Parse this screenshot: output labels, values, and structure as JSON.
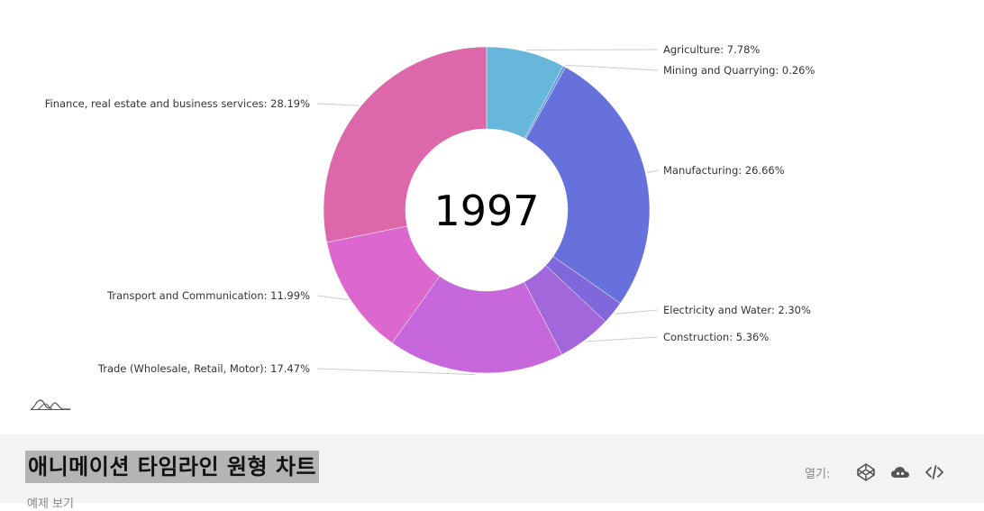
{
  "chart_data": {
    "type": "pie",
    "subtype": "donut",
    "center_label": "1997",
    "slices": [
      {
        "label": "Agriculture: 7.78%",
        "category": "Agriculture",
        "value": 7.78,
        "color": "#67b7dc"
      },
      {
        "label": "Mining and Quarrying: 0.26%",
        "category": "Mining and Quarrying",
        "value": 0.26,
        "color": "#6794dc"
      },
      {
        "label": "Manufacturing: 26.66%",
        "category": "Manufacturing",
        "value": 26.66,
        "color": "#6771dc"
      },
      {
        "label": "Electricity and Water: 2.30%",
        "category": "Electricity and Water",
        "value": 2.3,
        "color": "#8067dc"
      },
      {
        "label": "Construction: 5.36%",
        "category": "Construction",
        "value": 5.36,
        "color": "#a367dc"
      },
      {
        "label": "Trade (Wholesale, Retail, Motor): 17.47%",
        "category": "Trade (Wholesale, Retail, Motor)",
        "value": 17.47,
        "color": "#c767dc"
      },
      {
        "label": "Transport and Communication: 11.99%",
        "category": "Transport and Communication",
        "value": 11.99,
        "color": "#dc67ce"
      },
      {
        "label": "Finance, real estate and business services: 28.19%",
        "category": "Finance, real estate and business services",
        "value": 28.19,
        "color": "#dc67ab"
      }
    ]
  },
  "footer": {
    "title": "애니메이션 타임라인 원형 차트",
    "subtitle": "예제 보기",
    "open_label": "열기:",
    "icons": [
      "codepen-icon",
      "cloud-icon",
      "code-icon"
    ]
  }
}
